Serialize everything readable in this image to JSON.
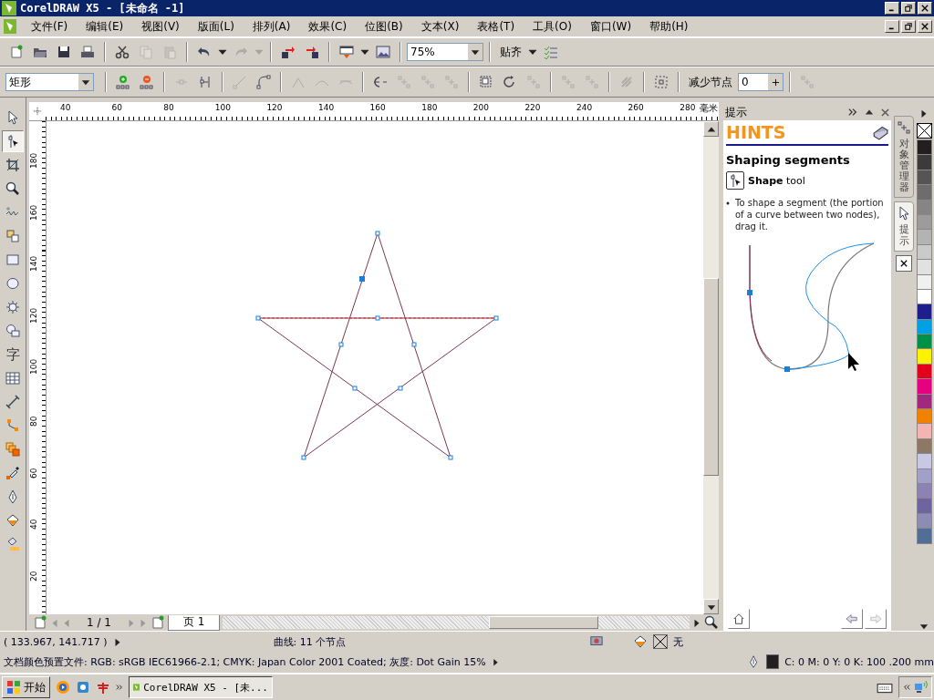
{
  "window": {
    "title": "CorelDRAW X5 - [未命名 -1]"
  },
  "menus": [
    "文件(F)",
    "编辑(E)",
    "视图(V)",
    "版面(L)",
    "排列(A)",
    "效果(C)",
    "位图(B)",
    "文本(X)",
    "表格(T)",
    "工具(O)",
    "窗口(W)",
    "帮助(H)"
  ],
  "standard_toolbar": {
    "groups": [
      [
        {
          "kind": "new",
          "disabled": false
        },
        {
          "kind": "open",
          "disabled": false
        },
        {
          "kind": "save",
          "disabled": false
        },
        {
          "kind": "print",
          "disabled": false
        }
      ],
      [
        {
          "kind": "cut",
          "disabled": false
        },
        {
          "kind": "copy",
          "disabled": true
        },
        {
          "kind": "paste",
          "disabled": true
        }
      ],
      [
        {
          "kind": "undo",
          "disabled": false
        },
        {
          "kind": "caret",
          "disabled": false
        },
        {
          "kind": "redo",
          "disabled": true
        },
        {
          "kind": "caret",
          "disabled": true
        }
      ],
      [
        {
          "kind": "import",
          "disabled": false
        },
        {
          "kind": "export",
          "disabled": false
        }
      ],
      [
        {
          "kind": "launcher",
          "disabled": false
        },
        {
          "kind": "caret",
          "disabled": false
        },
        {
          "kind": "welcome",
          "disabled": false
        }
      ]
    ],
    "zoom": "75%",
    "snap": "贴齐"
  },
  "property_bar": {
    "shape": "矩形",
    "groups": [
      [
        {
          "kind": "add-node",
          "disabled": false
        },
        {
          "kind": "delete-node",
          "disabled": false
        }
      ],
      [
        {
          "kind": "join",
          "disabled": true
        },
        {
          "kind": "break",
          "disabled": false
        }
      ],
      [
        {
          "kind": "to-line",
          "disabled": true
        },
        {
          "kind": "to-curve",
          "disabled": false
        }
      ],
      [
        {
          "kind": "cusp",
          "disabled": true
        },
        {
          "kind": "smooth",
          "disabled": true
        },
        {
          "kind": "symmetric",
          "disabled": true
        }
      ],
      [
        {
          "kind": "reverse",
          "disabled": false
        },
        {
          "kind": "nodes",
          "disabled": true
        },
        {
          "kind": "nodes",
          "disabled": true
        },
        {
          "kind": "nodes",
          "disabled": true
        }
      ],
      [
        {
          "kind": "stretch",
          "disabled": false
        },
        {
          "kind": "rotate",
          "disabled": false
        },
        {
          "kind": "nodes",
          "disabled": true
        }
      ],
      [
        {
          "kind": "nodes",
          "disabled": true
        },
        {
          "kind": "nodes",
          "disabled": true
        }
      ],
      [
        {
          "kind": "elastic",
          "disabled": true
        }
      ],
      [
        {
          "kind": "select-all",
          "disabled": false
        }
      ]
    ],
    "reduce_label": "减少节点",
    "reduce_value": "0",
    "last_disabled": true
  },
  "toolbox": [
    {
      "kind": "pick",
      "selected": false
    },
    {
      "kind": "shape",
      "selected": true
    },
    {
      "kind": "crop",
      "selected": false
    },
    {
      "kind": "zoom",
      "selected": false
    },
    {
      "kind": "freehand",
      "selected": false
    },
    {
      "kind": "smart-fill",
      "selected": false
    },
    {
      "kind": "rectangle",
      "selected": false
    },
    {
      "kind": "ellipse",
      "selected": false
    },
    {
      "kind": "polygon",
      "selected": false
    },
    {
      "kind": "basic-shapes",
      "selected": false
    },
    {
      "kind": "text",
      "label": "字",
      "selected": false
    },
    {
      "kind": "table",
      "selected": false
    },
    {
      "kind": "dimension",
      "selected": false
    },
    {
      "kind": "connector",
      "selected": false
    },
    {
      "kind": "blend",
      "selected": false
    },
    {
      "kind": "eyedropper",
      "selected": false
    },
    {
      "kind": "outline",
      "selected": false
    },
    {
      "kind": "fill",
      "selected": false
    },
    {
      "kind": "interactive-fill",
      "selected": false
    }
  ],
  "rulers": {
    "horizontal": [
      "40",
      "60",
      "80",
      "100",
      "120",
      "140",
      "160",
      "180",
      "200",
      "220",
      "240",
      "260",
      "280"
    ],
    "unit": "毫米",
    "vertical": [
      "180",
      "160",
      "140",
      "120",
      "100",
      "80",
      "60",
      "40",
      "20"
    ]
  },
  "page_nav": {
    "count": "1 / 1",
    "tab": "页 1"
  },
  "docker": {
    "title": "提示",
    "brand": "HINTS",
    "heading": "Shaping segments",
    "tool": "**Shape** tool",
    "bullet": "To shape a segment (the portion of a curve between two nodes), drag it."
  },
  "docker_tabs": [
    {
      "label": "对象管理器",
      "selected": false
    },
    {
      "label": "提示",
      "selected": true
    }
  ],
  "palette": [
    {
      "color": "#231f20"
    },
    {
      "color": "#3d3a3b"
    },
    {
      "color": "#565455"
    },
    {
      "color": "#6e6c6d"
    },
    {
      "color": "#868485"
    },
    {
      "color": "#9d9b9c"
    },
    {
      "color": "#b4b3b4"
    },
    {
      "color": "#cbcacb"
    },
    {
      "color": "#e2e1e1"
    },
    {
      "color": "#f0f0f0"
    },
    {
      "color": "#ffffff"
    },
    {
      "color": "#1e1e8c"
    },
    {
      "color": "#00a0e4"
    },
    {
      "color": "#009048"
    },
    {
      "color": "#fff200"
    },
    {
      "color": "#e4001c"
    },
    {
      "color": "#e4007f"
    },
    {
      "color": "#a0287f"
    },
    {
      "color": "#f08200"
    },
    {
      "color": "#f5b4b4"
    },
    {
      "color": "#8c7864"
    },
    {
      "color": "#c8c8e6"
    },
    {
      "color": "#a0a0c8"
    },
    {
      "color": "#8c82b4"
    },
    {
      "color": "#6e64a0"
    },
    {
      "color": "#8c8cb4"
    },
    {
      "color": "#506e96"
    }
  ],
  "status_bar": {
    "coords": "( 133.967, 141.717 )",
    "object": "曲线: 11 个节点",
    "fill": "无",
    "profile": "文档颜色预置文件: RGB: sRGB IEC61966-2.1; CMYK: Japan Color 2001 Coated; 灰度: Dot Gain 15%",
    "outline": "C: 0 M: 0 Y: 0 K: 100  .200 mm"
  },
  "taskbar": {
    "start": "开始",
    "task": "CorelDRAW X5 - [未..."
  }
}
